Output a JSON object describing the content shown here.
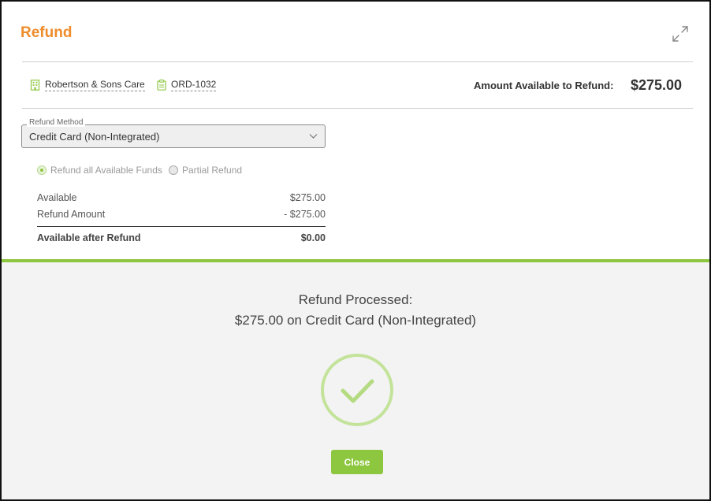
{
  "dialog": {
    "title": "Refund"
  },
  "header": {
    "customer": "Robertson & Sons Care",
    "order": "ORD-1032",
    "available_label": "Amount Available to Refund:",
    "available_value": "$275.00"
  },
  "refund_method": {
    "legend": "Refund Method",
    "value": "Credit Card (Non-Integrated)"
  },
  "refund_options": [
    {
      "label": "Refund all Available Funds",
      "selected": true
    },
    {
      "label": "Partial Refund",
      "selected": false
    }
  ],
  "summary": {
    "rows": [
      {
        "label": "Available",
        "value": "$275.00"
      },
      {
        "label": "Refund Amount",
        "value": "- $275.00"
      }
    ],
    "total": {
      "label": "Available after Refund",
      "value": "$0.00"
    }
  },
  "result": {
    "line1": "Refund Processed:",
    "line2": "$275.00 on Credit Card (Non-Integrated)",
    "close_label": "Close"
  },
  "colors": {
    "accent_orange": "#ee8d2b",
    "accent_green": "#8dc63f"
  },
  "icons": [
    "building-icon",
    "clipboard-icon",
    "expand-icon",
    "chevron-down-icon",
    "check-circle-icon"
  ]
}
